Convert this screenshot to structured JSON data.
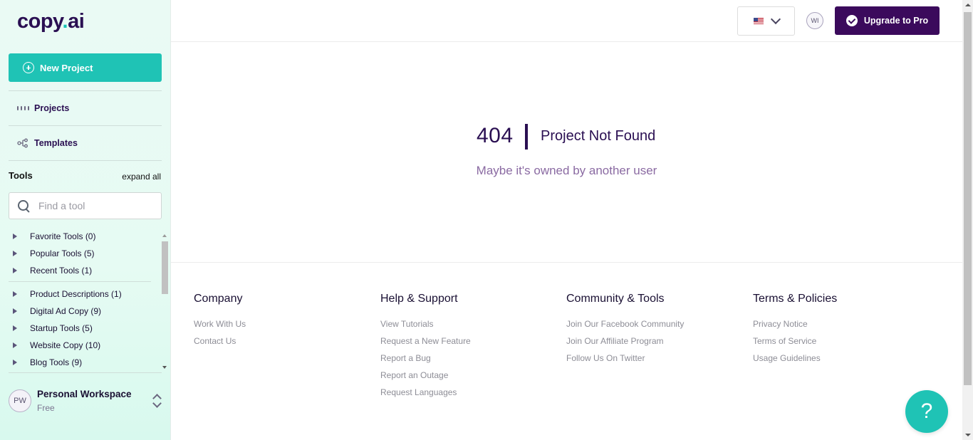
{
  "brand": {
    "name_main": "copy",
    "name_dot": ".",
    "name_tail": "ai"
  },
  "sidebar": {
    "new_project_label": "New Project",
    "nav": [
      {
        "label": "Projects",
        "icon": "grid-icon"
      },
      {
        "label": "Templates",
        "icon": "templates-icon"
      }
    ],
    "tools_heading": "Tools",
    "expand_all_label": "expand all",
    "search_placeholder": "Find a tool",
    "tool_groups_top": [
      {
        "label": "Favorite Tools (0)"
      },
      {
        "label": "Popular Tools (5)"
      },
      {
        "label": "Recent Tools (1)"
      }
    ],
    "tool_groups": [
      {
        "label": "Product Descriptions (1)"
      },
      {
        "label": "Digital Ad Copy (9)"
      },
      {
        "label": "Startup Tools (5)"
      },
      {
        "label": "Website Copy (10)"
      },
      {
        "label": "Blog Tools (9)"
      }
    ],
    "workspace": {
      "initials": "PW",
      "name": "Personal Workspace",
      "plan": "Free"
    }
  },
  "header": {
    "language_flag": "us-flag-icon",
    "user_initials": "WI",
    "upgrade_label": "Upgrade to Pro"
  },
  "error": {
    "code": "404",
    "title": "Project Not Found",
    "subtitle": "Maybe it's owned by another user"
  },
  "footer": {
    "columns": [
      {
        "heading": "Company",
        "links": [
          "Work With Us",
          "Contact Us"
        ]
      },
      {
        "heading": "Help & Support",
        "links": [
          "View Tutorials",
          "Request a New Feature",
          "Report a Bug",
          "Report an Outage",
          "Request Languages"
        ]
      },
      {
        "heading": "Community & Tools",
        "links": [
          "Join Our Facebook Community",
          "Join Our Affiliate Program",
          "Follow Us On Twitter"
        ]
      },
      {
        "heading": "Terms & Policies",
        "links": [
          "Privacy Notice",
          "Terms of Service",
          "Usage Guidelines"
        ]
      }
    ]
  },
  "help_button": {
    "label": "?"
  },
  "colors": {
    "accent": "#1fc3b5",
    "brand_purple": "#3b0a5c",
    "text_dark": "#2a0f52",
    "sub_text": "#8a6aa2"
  }
}
